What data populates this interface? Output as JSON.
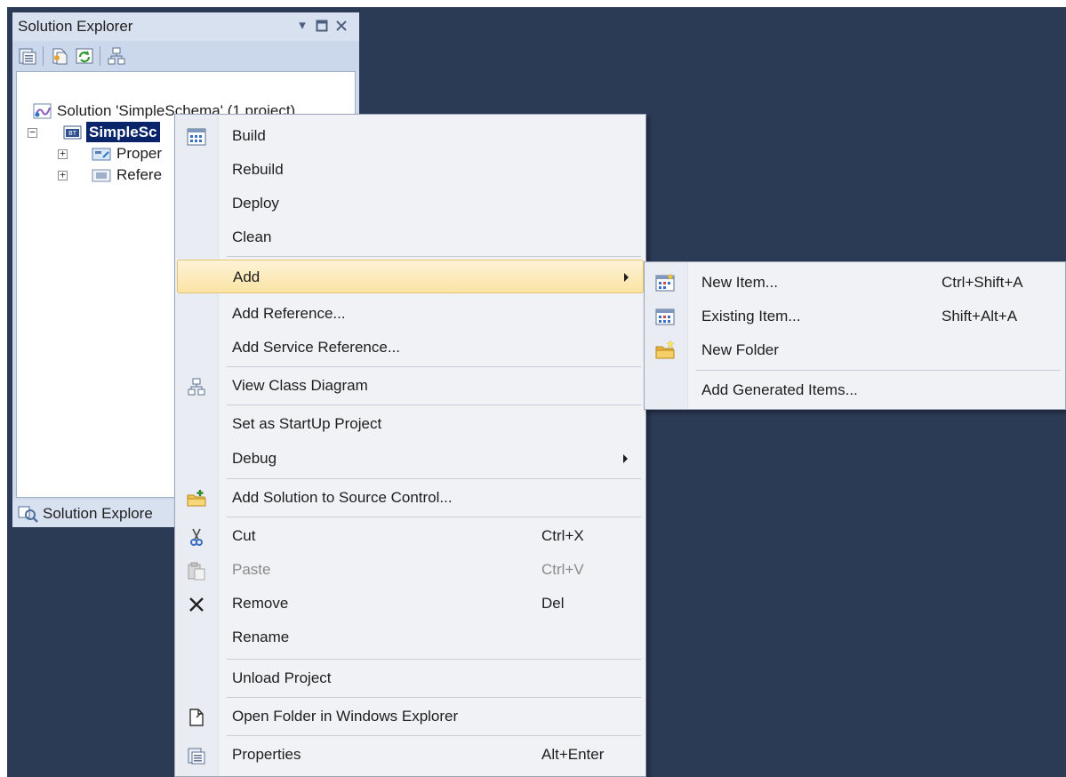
{
  "solution_explorer": {
    "title": "Solution Explorer",
    "title_buttons": [
      "dropdown-icon",
      "maximize-icon",
      "close-icon"
    ],
    "toolbar_icons": [
      "properties-icon",
      "show-all-files-icon",
      "refresh-icon",
      "view-class-diagram-icon"
    ],
    "tree": {
      "solution_label": "Solution 'SimpleSchema' (1 project)",
      "project_label": "SimpleSc",
      "children": [
        {
          "label": "Proper",
          "expander": "+"
        },
        {
          "label": "Refere",
          "expander": "+"
        }
      ],
      "project_expander": "−"
    },
    "footer_tab": "Solution Explore"
  },
  "context_menu": {
    "items": [
      {
        "label": "Build",
        "icon": "build-icon"
      },
      {
        "label": "Rebuild"
      },
      {
        "label": "Deploy"
      },
      {
        "label": "Clean"
      },
      {
        "label": "Add",
        "submenu": true,
        "highlighted": true
      },
      {
        "label": "Add Reference..."
      },
      {
        "label": "Add Service Reference..."
      },
      {
        "label": "View Class Diagram",
        "icon": "class-diagram-icon"
      },
      {
        "label": "Set as StartUp Project"
      },
      {
        "label": "Debug",
        "submenu": true
      },
      {
        "label": "Add Solution to Source Control...",
        "icon": "add-to-source-control-icon"
      },
      {
        "label": "Cut",
        "shortcut": "Ctrl+X",
        "icon": "cut-icon"
      },
      {
        "label": "Paste",
        "shortcut": "Ctrl+V",
        "icon": "paste-icon",
        "disabled": true
      },
      {
        "label": "Remove",
        "shortcut": "Del",
        "icon": "remove-icon"
      },
      {
        "label": "Rename"
      },
      {
        "label": "Unload Project"
      },
      {
        "label": "Open Folder in Windows Explorer",
        "icon": "open-folder-icon"
      },
      {
        "label": "Properties",
        "shortcut": "Alt+Enter",
        "icon": "properties-icon"
      }
    ]
  },
  "add_submenu": {
    "items": [
      {
        "label": "New Item...",
        "shortcut": "Ctrl+Shift+A",
        "icon": "new-item-icon"
      },
      {
        "label": "Existing Item...",
        "shortcut": "Shift+Alt+A",
        "icon": "existing-item-icon"
      },
      {
        "label": "New Folder",
        "icon": "new-folder-icon"
      },
      {
        "label": "Add Generated Items..."
      }
    ]
  },
  "colors": {
    "desktop": "#2b3a55",
    "menu_background": "#f0f2f6",
    "highlight": "#fbe3a4",
    "selection": "#0a246a"
  }
}
